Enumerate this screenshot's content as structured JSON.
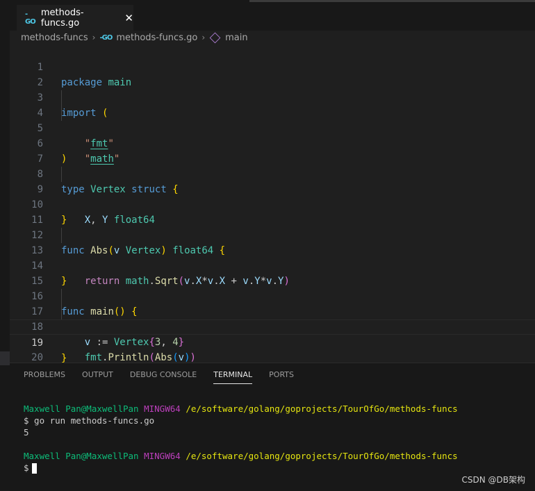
{
  "tab": {
    "label": "methods-funcs.go",
    "close": "✕",
    "go_glyph": "-GO"
  },
  "breadcrumb": {
    "folder": "methods-funcs",
    "file": "methods-funcs.go",
    "symbol": "main"
  },
  "code_lines": [
    {
      "n": "1",
      "text": "package main"
    },
    {
      "n": "2",
      "text": ""
    },
    {
      "n": "3",
      "text": "import ("
    },
    {
      "n": "4",
      "text": "\"fmt\""
    },
    {
      "n": "5",
      "text": "\"math\""
    },
    {
      "n": "6",
      "text": ")"
    },
    {
      "n": "7",
      "text": ""
    },
    {
      "n": "8",
      "text": "type Vertex struct {"
    },
    {
      "n": "9",
      "text": "X, Y float64"
    },
    {
      "n": "10",
      "text": "}"
    },
    {
      "n": "11",
      "text": ""
    },
    {
      "n": "12",
      "text": "func Abs(v Vertex) float64 {"
    },
    {
      "n": "13",
      "text": "return math.Sqrt(v.X*v.X + v.Y*v.Y)"
    },
    {
      "n": "14",
      "text": "}"
    },
    {
      "n": "15",
      "text": ""
    },
    {
      "n": "16",
      "text": "func main() {"
    },
    {
      "n": "17",
      "text": "v := Vertex{3, 4}"
    },
    {
      "n": "18",
      "text": "fmt.Println(Abs(v))"
    },
    {
      "n": "19",
      "text": "}"
    },
    {
      "n": "20",
      "text": ""
    }
  ],
  "panel": {
    "tabs": [
      "PROBLEMS",
      "OUTPUT",
      "DEBUG CONSOLE",
      "TERMINAL",
      "PORTS"
    ],
    "active_tab": "TERMINAL"
  },
  "terminal": {
    "user": "Maxwell Pan@MaxwellPan",
    "shell": "MINGW64",
    "path": "/e/software/golang/goprojects/TourOfGo/methods-funcs",
    "command": "$ go run methods-funcs.go",
    "output": "5",
    "prompt": "$"
  },
  "watermark": "CSDN @DB架构"
}
